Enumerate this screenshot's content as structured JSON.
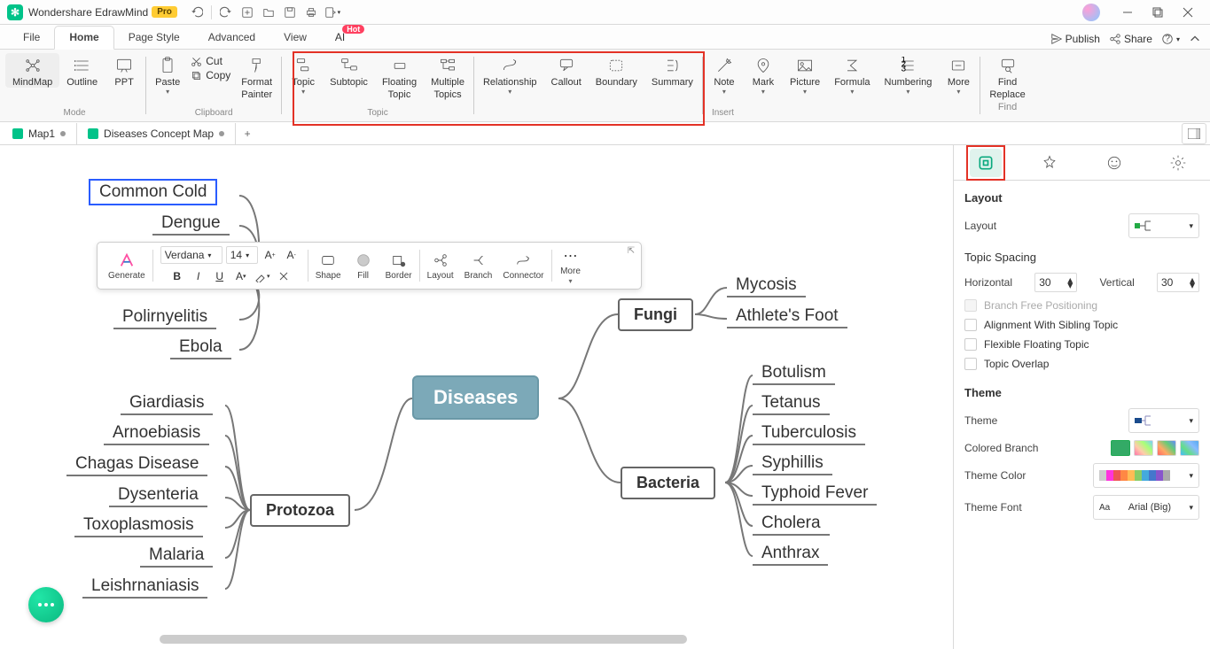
{
  "app": {
    "title": "Wondershare EdrawMind",
    "pro": "Pro"
  },
  "title_tools": {
    "undo": "↶",
    "redo": "↷"
  },
  "menu": {
    "file": "File",
    "home": "Home",
    "pagestyle": "Page Style",
    "advanced": "Advanced",
    "view": "View",
    "ai": "AI",
    "hot": "Hot",
    "publish": "Publish",
    "share": "Share"
  },
  "ribbon": {
    "mode": {
      "mindmap": "MindMap",
      "outline": "Outline",
      "ppt": "PPT",
      "group": "Mode"
    },
    "clipboard": {
      "paste": "Paste",
      "cut": "Cut",
      "copy": "Copy",
      "format_painter1": "Format",
      "format_painter2": "Painter",
      "group": "Clipboard"
    },
    "topic": {
      "topic": "Topic",
      "subtopic": "Subtopic",
      "floating1": "Floating",
      "floating2": "Topic",
      "multiple1": "Multiple",
      "multiple2": "Topics",
      "group": "Topic"
    },
    "insert": {
      "relationship": "Relationship",
      "callout": "Callout",
      "boundary": "Boundary",
      "summary": "Summary",
      "note": "Note",
      "mark": "Mark",
      "picture": "Picture",
      "formula": "Formula",
      "numbering": "Numbering",
      "more": "More",
      "findreplace1": "Find",
      "findreplace2": "Replace",
      "findreplace3": "Find",
      "group": "Insert"
    }
  },
  "doctabs": {
    "tab1": "Map1",
    "tab2": "Diseases Concept Map",
    "add": "+"
  },
  "map": {
    "central": "Diseases",
    "branches": {
      "fungi": "Fungi",
      "bacteria": "Bacteria",
      "protozoa": "Protozoa"
    },
    "leaves": {
      "commoncold": "Common Cold",
      "dengue": "Dengue",
      "polio": "Polirnyelitis",
      "ebola": "Ebola",
      "giardiasis": "Giardiasis",
      "arnoebiasis": "Arnoebiasis",
      "chagas": "Chagas Disease",
      "dysenteria": "Dysenteria",
      "toxoplasmosis": "Toxoplasmosis",
      "malaria": "Malaria",
      "leish": "Leishrnaniasis",
      "mycosis": "Mycosis",
      "athlete": "Athlete's Foot",
      "botulism": "Botulism",
      "tetanus": "Tetanus",
      "tb": "Tuberculosis",
      "syphilis": "Syphillis",
      "typhoid": "Typhoid Fever",
      "cholera": "Cholera",
      "anthrax": "Anthrax"
    }
  },
  "fmt": {
    "generate": "Generate",
    "font": "Verdana",
    "size": "14",
    "shape": "Shape",
    "fill": "Fill",
    "border": "Border",
    "layout": "Layout",
    "branch": "Branch",
    "connector": "Connector",
    "more": "More"
  },
  "panel": {
    "layout_title": "Layout",
    "layout_label": "Layout",
    "spacing_title": "Topic Spacing",
    "horizontal": "Horizontal",
    "vertical": "Vertical",
    "h_val": "30",
    "v_val": "30",
    "branch_free": "Branch Free Positioning",
    "sibling": "Alignment With Sibling Topic",
    "flex": "Flexible Floating Topic",
    "overlap": "Topic Overlap",
    "theme_title": "Theme",
    "theme_label": "Theme",
    "colored_branch": "Colored Branch",
    "theme_color": "Theme Color",
    "theme_font": "Theme Font",
    "theme_font_val": "Arial (Big)"
  }
}
